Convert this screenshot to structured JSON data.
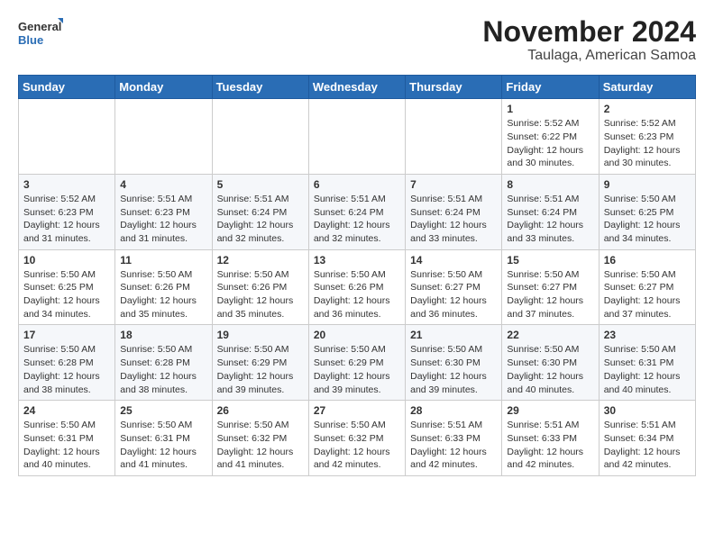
{
  "header": {
    "logo_line1": "General",
    "logo_line2": "Blue",
    "title": "November 2024",
    "subtitle": "Taulaga, American Samoa"
  },
  "days_of_week": [
    "Sunday",
    "Monday",
    "Tuesday",
    "Wednesday",
    "Thursday",
    "Friday",
    "Saturday"
  ],
  "weeks": [
    [
      {
        "day": "",
        "info": ""
      },
      {
        "day": "",
        "info": ""
      },
      {
        "day": "",
        "info": ""
      },
      {
        "day": "",
        "info": ""
      },
      {
        "day": "",
        "info": ""
      },
      {
        "day": "1",
        "info": "Sunrise: 5:52 AM\nSunset: 6:22 PM\nDaylight: 12 hours and 30 minutes."
      },
      {
        "day": "2",
        "info": "Sunrise: 5:52 AM\nSunset: 6:23 PM\nDaylight: 12 hours and 30 minutes."
      }
    ],
    [
      {
        "day": "3",
        "info": "Sunrise: 5:52 AM\nSunset: 6:23 PM\nDaylight: 12 hours and 31 minutes."
      },
      {
        "day": "4",
        "info": "Sunrise: 5:51 AM\nSunset: 6:23 PM\nDaylight: 12 hours and 31 minutes."
      },
      {
        "day": "5",
        "info": "Sunrise: 5:51 AM\nSunset: 6:24 PM\nDaylight: 12 hours and 32 minutes."
      },
      {
        "day": "6",
        "info": "Sunrise: 5:51 AM\nSunset: 6:24 PM\nDaylight: 12 hours and 32 minutes."
      },
      {
        "day": "7",
        "info": "Sunrise: 5:51 AM\nSunset: 6:24 PM\nDaylight: 12 hours and 33 minutes."
      },
      {
        "day": "8",
        "info": "Sunrise: 5:51 AM\nSunset: 6:24 PM\nDaylight: 12 hours and 33 minutes."
      },
      {
        "day": "9",
        "info": "Sunrise: 5:50 AM\nSunset: 6:25 PM\nDaylight: 12 hours and 34 minutes."
      }
    ],
    [
      {
        "day": "10",
        "info": "Sunrise: 5:50 AM\nSunset: 6:25 PM\nDaylight: 12 hours and 34 minutes."
      },
      {
        "day": "11",
        "info": "Sunrise: 5:50 AM\nSunset: 6:26 PM\nDaylight: 12 hours and 35 minutes."
      },
      {
        "day": "12",
        "info": "Sunrise: 5:50 AM\nSunset: 6:26 PM\nDaylight: 12 hours and 35 minutes."
      },
      {
        "day": "13",
        "info": "Sunrise: 5:50 AM\nSunset: 6:26 PM\nDaylight: 12 hours and 36 minutes."
      },
      {
        "day": "14",
        "info": "Sunrise: 5:50 AM\nSunset: 6:27 PM\nDaylight: 12 hours and 36 minutes."
      },
      {
        "day": "15",
        "info": "Sunrise: 5:50 AM\nSunset: 6:27 PM\nDaylight: 12 hours and 37 minutes."
      },
      {
        "day": "16",
        "info": "Sunrise: 5:50 AM\nSunset: 6:27 PM\nDaylight: 12 hours and 37 minutes."
      }
    ],
    [
      {
        "day": "17",
        "info": "Sunrise: 5:50 AM\nSunset: 6:28 PM\nDaylight: 12 hours and 38 minutes."
      },
      {
        "day": "18",
        "info": "Sunrise: 5:50 AM\nSunset: 6:28 PM\nDaylight: 12 hours and 38 minutes."
      },
      {
        "day": "19",
        "info": "Sunrise: 5:50 AM\nSunset: 6:29 PM\nDaylight: 12 hours and 39 minutes."
      },
      {
        "day": "20",
        "info": "Sunrise: 5:50 AM\nSunset: 6:29 PM\nDaylight: 12 hours and 39 minutes."
      },
      {
        "day": "21",
        "info": "Sunrise: 5:50 AM\nSunset: 6:30 PM\nDaylight: 12 hours and 39 minutes."
      },
      {
        "day": "22",
        "info": "Sunrise: 5:50 AM\nSunset: 6:30 PM\nDaylight: 12 hours and 40 minutes."
      },
      {
        "day": "23",
        "info": "Sunrise: 5:50 AM\nSunset: 6:31 PM\nDaylight: 12 hours and 40 minutes."
      }
    ],
    [
      {
        "day": "24",
        "info": "Sunrise: 5:50 AM\nSunset: 6:31 PM\nDaylight: 12 hours and 40 minutes."
      },
      {
        "day": "25",
        "info": "Sunrise: 5:50 AM\nSunset: 6:31 PM\nDaylight: 12 hours and 41 minutes."
      },
      {
        "day": "26",
        "info": "Sunrise: 5:50 AM\nSunset: 6:32 PM\nDaylight: 12 hours and 41 minutes."
      },
      {
        "day": "27",
        "info": "Sunrise: 5:50 AM\nSunset: 6:32 PM\nDaylight: 12 hours and 42 minutes."
      },
      {
        "day": "28",
        "info": "Sunrise: 5:51 AM\nSunset: 6:33 PM\nDaylight: 12 hours and 42 minutes."
      },
      {
        "day": "29",
        "info": "Sunrise: 5:51 AM\nSunset: 6:33 PM\nDaylight: 12 hours and 42 minutes."
      },
      {
        "day": "30",
        "info": "Sunrise: 5:51 AM\nSunset: 6:34 PM\nDaylight: 12 hours and 42 minutes."
      }
    ]
  ]
}
